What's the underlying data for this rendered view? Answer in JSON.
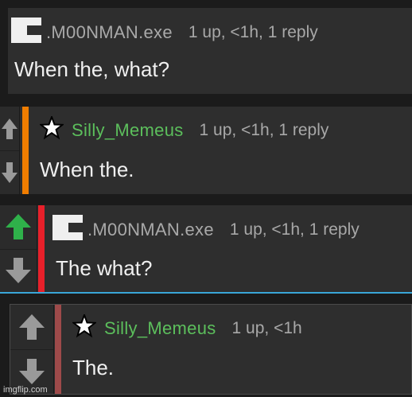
{
  "comments": [
    {
      "username": ".M00NMAN.exe",
      "username_color": "#a9a9a9",
      "avatar_icon": "moonman-logo-icon",
      "meta": "1 up, <1h, 1 reply",
      "text": "When the, what?"
    },
    {
      "username": "Silly_Memeus",
      "username_color": "#5cbf5c",
      "avatar_icon": "star-icon",
      "meta": "1 up, <1h, 1 reply",
      "text": "When the.",
      "bar_color": "#f07d00",
      "upvoted": false
    },
    {
      "username": ".M00NMAN.exe",
      "username_color": "#a9a9a9",
      "avatar_icon": "moonman-logo-icon",
      "meta": "1 up, <1h, 1 reply",
      "text": "The what?",
      "bar_color": "#e8202a",
      "highlight_border": "#3aa6d8",
      "upvoted": true
    },
    {
      "username": "Silly_Memeus",
      "username_color": "#5cbf5c",
      "avatar_icon": "star-icon",
      "meta": "1 up, <1h",
      "text": "The.",
      "bar_color": "#9e4a4a",
      "upvoted": false
    }
  ],
  "colors": {
    "upvote_active": "#2fb14a",
    "vote_inactive": "#9a9a9a"
  },
  "watermark": "imgflip.com"
}
